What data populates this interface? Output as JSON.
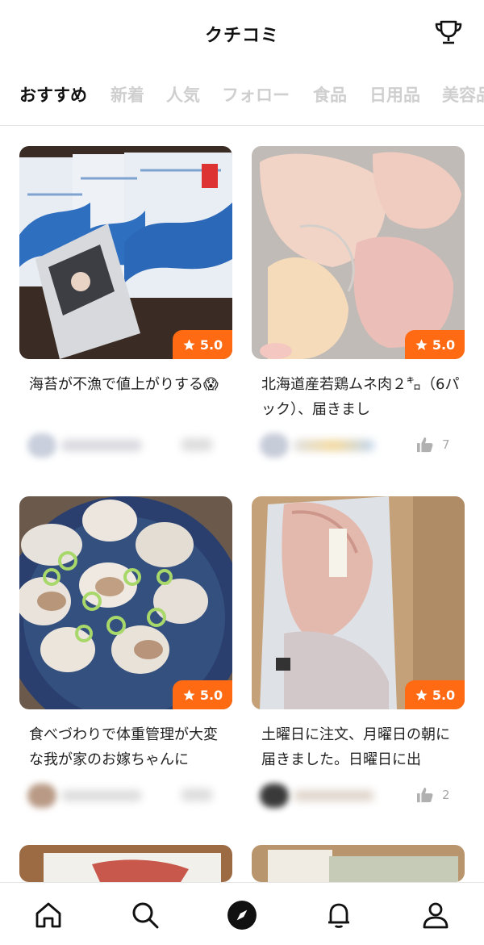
{
  "header": {
    "title": "クチコミ",
    "trophy_icon": "trophy-icon"
  },
  "tabs": [
    {
      "label": "おすすめ",
      "active": true
    },
    {
      "label": "新着",
      "active": false
    },
    {
      "label": "人気",
      "active": false
    },
    {
      "label": "フォロー",
      "active": false
    },
    {
      "label": "食品",
      "active": false
    },
    {
      "label": "日用品",
      "active": false
    },
    {
      "label": "美容品",
      "active": false
    }
  ],
  "posts": [
    {
      "rating": "5.0",
      "caption": "海苔が不漁で値上がりする😱",
      "likes": "",
      "photo": "seaweed packs"
    },
    {
      "rating": "5.0",
      "caption": "北海道産若鶏ムネ肉２㌔（6パック）、届きまし",
      "likes": "7",
      "photo": "chicken breast"
    },
    {
      "rating": "5.0",
      "caption": "食べづわりで体重管理が大変な我が家のお嫁ちゃんに",
      "likes": "",
      "photo": "clams"
    },
    {
      "rating": "5.0",
      "caption": "土曜日に注文、月曜日の朝に届きました。日曜日に出",
      "likes": "2",
      "photo": "fish fillet"
    },
    {
      "rating": "",
      "caption": "",
      "likes": "",
      "photo": "dish"
    },
    {
      "rating": "",
      "caption": "",
      "likes": "",
      "photo": "box"
    }
  ],
  "colors": {
    "accent": "#ff6a13",
    "inactive_tab": "#cfcfcf",
    "text": "#111111"
  },
  "bottom_nav": [
    "home-icon",
    "search-icon",
    "compass-icon",
    "bell-icon",
    "profile-icon"
  ]
}
